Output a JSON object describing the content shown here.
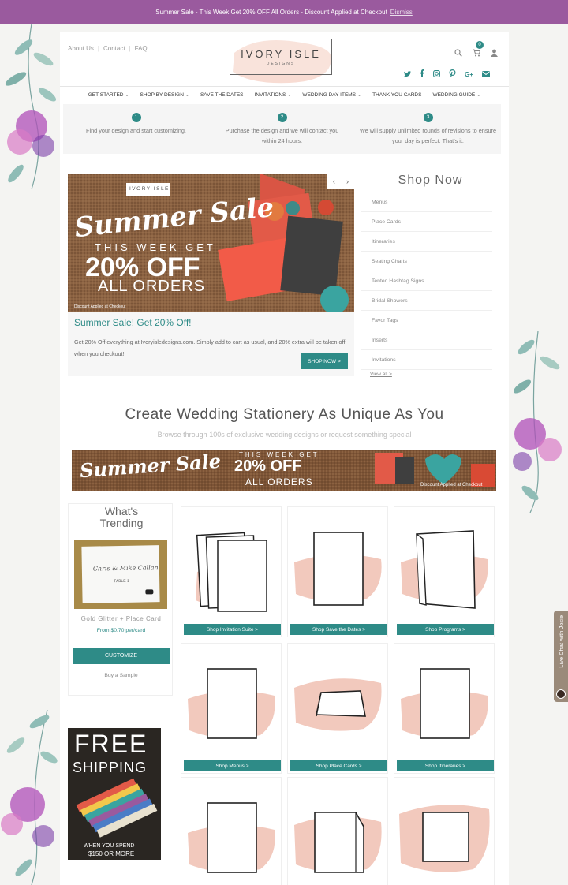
{
  "announcement": {
    "text": "Summer Sale - This Week Get 20% OFF All Orders - Discount Applied at Checkout",
    "dismiss": "Dismiss"
  },
  "header": {
    "links": [
      "About Us",
      "Contact",
      "FAQ"
    ],
    "logo_name": "IVORY ISLE",
    "logo_sub": "DESIGNS",
    "cart_count": "0"
  },
  "nav": [
    {
      "label": "GET STARTED",
      "dropdown": true
    },
    {
      "label": "SHOP BY DESIGN",
      "dropdown": true
    },
    {
      "label": "SAVE THE DATES",
      "dropdown": false
    },
    {
      "label": "INVITATIONS",
      "dropdown": true
    },
    {
      "label": "WEDDING DAY ITEMS",
      "dropdown": true
    },
    {
      "label": "THANK YOU CARDS",
      "dropdown": false
    },
    {
      "label": "WEDDING GUIDE",
      "dropdown": true
    }
  ],
  "steps": [
    {
      "num": "1",
      "text": "Find your design and start customizing."
    },
    {
      "num": "2",
      "text": "Purchase the design and we will contact you within 24 hours."
    },
    {
      "num": "3",
      "text": "We will supply unlimited rounds of revisions to ensure your day is perfect. That's it."
    }
  ],
  "hero": {
    "img_logo": "IVORY ISLE",
    "img_line1": "Summer Sale",
    "img_line2": "THIS WEEK GET",
    "img_line3": "20% OFF",
    "img_line4": "ALL ORDERS",
    "img_note": "Discount Applied at Checkout",
    "title": "Summer Sale! Get 20% Off!",
    "text": "Get 20% Off everything at Ivoryisledesigns.com. Simply add to cart as usual, and 20% extra will be taken off when you checkout!",
    "button": "SHOP NOW >",
    "prev": "‹",
    "next": "›"
  },
  "shop_now": {
    "title": "Shop Now",
    "items": [
      "Menus",
      "Place Cards",
      "Itineraries",
      "Seating Charts",
      "Tented Hashtag Signs",
      "Bridal Showers",
      "Favor Tags",
      "Inserts",
      "Invitations"
    ],
    "view_all": "View all >"
  },
  "section": {
    "title": "Create Wedding Stationery As Unique As You",
    "subtitle": "Browse through 100s of exclusive wedding designs or request something special"
  },
  "banner": {
    "line1": "Summer Sale",
    "line2": "THIS WEEK GET",
    "line3": "20% OFF",
    "line4": "ALL ORDERS",
    "note": "Discount Applied at Checkout"
  },
  "trending": {
    "title": "What's Trending",
    "card_text": "Chris & Mike Callan",
    "card_table": "TABLE 1",
    "name": "Gold Glitter + Place Card",
    "price": "From $0.70 per/card",
    "customize": "CUSTOMIZE",
    "sample": "Buy a Sample"
  },
  "free_shipping": {
    "line1": "FREE",
    "line2": "SHIPPING",
    "line3": "WHEN YOU SPEND",
    "line4": "$150 OR MORE"
  },
  "tiles": [
    {
      "label": "Shop Invitation Suite >",
      "shape": "suite"
    },
    {
      "label": "Shop Save the Dates >",
      "shape": "tall"
    },
    {
      "label": "Shop Programs >",
      "shape": "folded"
    },
    {
      "label": "Shop Menus >",
      "shape": "tall-narrow"
    },
    {
      "label": "Shop Place Cards >",
      "shape": "tent"
    },
    {
      "label": "Shop Itineraries >",
      "shape": "tall-narrow"
    },
    {
      "label": "",
      "shape": "tall-narrow"
    },
    {
      "label": "",
      "shape": "folded-small"
    },
    {
      "label": "",
      "shape": "square"
    }
  ],
  "chat": {
    "label": "Live Chat with Josie"
  },
  "colors": {
    "accent": "#2e8b87",
    "topbar": "#9a5a9e",
    "brush": "#f2c9bd"
  }
}
